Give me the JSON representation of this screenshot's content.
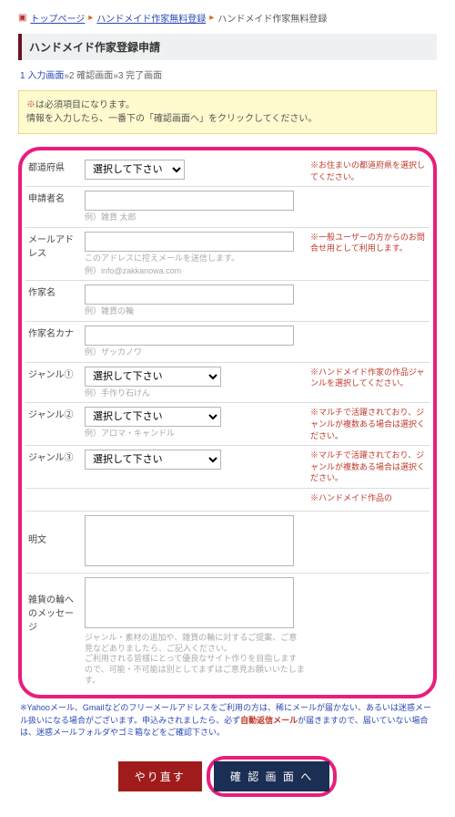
{
  "breadcrumb": {
    "home": "トップページ",
    "mid": "ハンドメイド作家無料登録",
    "current": "ハンドメイド作家無料登録"
  },
  "title": "ハンドメイド作家登録申請",
  "steps": {
    "s1": "1 入力画面",
    "sep": "»",
    "s2": "2 確認画面",
    "s3": "3 完了画面"
  },
  "notice": {
    "line1_prefix": "※",
    "line1": "は必須項目になります。",
    "line2": "情報を入力したら、一番下の「確認画面へ」をクリックしてください。"
  },
  "select_placeholder": "選択して下さい",
  "rows": {
    "pref": {
      "label": "都道府県",
      "side": "※お住まいの都道府県を選択してください。"
    },
    "name": {
      "label": "申請者名",
      "hint": "例）雑貨 太郎"
    },
    "mail": {
      "label": "メールアドレス",
      "hint1": "このアドレスに控えメールを送信します。",
      "hint2": "例）info@zakkanowa.com",
      "side": "※一般ユーザーの方からのお問合せ用として利用します。"
    },
    "artist": {
      "label": "作家名",
      "hint": "例）雑貨の輪"
    },
    "kana": {
      "label": "作家名カナ",
      "hint": "例）ザッカノワ"
    },
    "genre1": {
      "label": "ジャンル①",
      "hint": "例）手作り石けん",
      "side": "※ハンドメイド作家の作品ジャンルを選択してください。"
    },
    "genre2": {
      "label": "ジャンル②",
      "hint": "例）アロマ・キャンドル",
      "side": "※マルチで活躍されており、ジャンルが複数ある場合は選択ください。"
    },
    "genre3": {
      "label": "ジャンル③",
      "side": "※マルチで活躍されており、ジャンルが複数ある場合は選択ください。"
    },
    "works": {
      "side": "※ハンドメイド作品の"
    },
    "intro": {
      "label": "明文"
    },
    "msg": {
      "label": "雑貨の輪へのメッセージ",
      "hint": "ジャンル・素材の追加や、雑貨の輪に対するご提案、ご意見などありましたら、ご記入ください。\nご利用される皆様にとって優良なサイト作りを目指しますので、可能・不可能は別としてまずはご意見お願いいたします。"
    }
  },
  "mail_note": {
    "text1": "※Yahooメール、Gmailなどのフリーメールアドレスをご利用の方は、稀にメールが届かない、あるいは迷惑メール扱いになる場合がございます。申込みされましたら、必ず",
    "bold": "自動返信メール",
    "text2": "が届きますので、届いていない場合は、迷惑メールフォルダやゴミ箱などをご確認下さい。"
  },
  "buttons": {
    "reset": "やり直す",
    "confirm": "確 認 画 面 へ"
  }
}
